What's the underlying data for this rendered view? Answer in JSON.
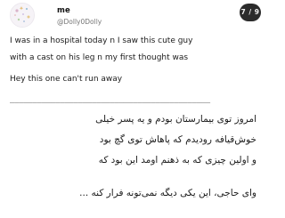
{
  "post": {
    "display_name": "me",
    "handle": "@Dolly0Dolly",
    "page_counter": "7 / 9",
    "avatar_icon": "sparkle-avatar-icon",
    "lines_en": [
      "I was in a hospital today n I saw this cute guy",
      "with a cast on his leg n my first thought was",
      "Hey this one can't run away"
    ],
    "divider": "____________________________________________",
    "lines_fa": [
      "امروز توی بیمارستان بودم و یه پسر خیلی",
      "خوش‌قیافه رودیدم که پاهاش توی گچ بود",
      "و اولین چیزی که به ذهنم اومد این بود که",
      "وای حاجی، این یکی دیگه نمی‌تونه فرار کنه ..."
    ],
    "colors": {
      "background": "#ffffff",
      "text": "#1b1b1b",
      "handle": "#777777",
      "counter_bg": "#2b2b2b",
      "counter_text": "#f2f2f2"
    }
  }
}
